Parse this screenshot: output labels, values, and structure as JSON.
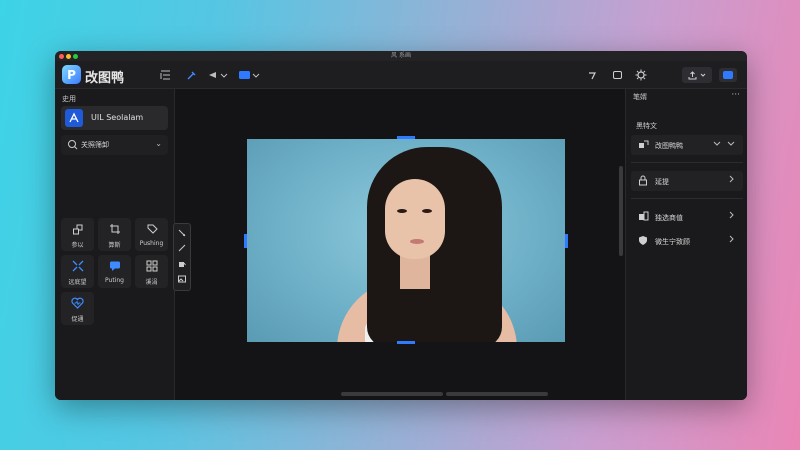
{
  "window": {
    "title": "风 系画"
  },
  "toolbar": {
    "logo_letter": "P",
    "app_name": "改图鸭",
    "icons": [
      "list-icon",
      "brush-icon",
      "brush-size-dropdown-icon",
      "color-dropdown-icon",
      "redo-icon",
      "comment-icon",
      "settings-icon",
      "export-icon",
      "profile-icon"
    ]
  },
  "left_panel": {
    "title": "史用",
    "project": {
      "icon": "pen-tool-icon",
      "name": "UIL Seolalam"
    },
    "preset": {
      "label": "关照筛卸",
      "icon": "spot-heal-icon",
      "chevron": "⌄"
    },
    "tools": [
      {
        "label": "参以",
        "icon": "layers-icon",
        "accent": false
      },
      {
        "label": "算斯",
        "icon": "crop-icon",
        "accent": false
      },
      {
        "label": "Pushing",
        "icon": "tag-icon",
        "accent": false
      },
      {
        "label": "远底望",
        "icon": "expand-icon",
        "accent": true
      },
      {
        "label": "Puting",
        "icon": "chat-icon",
        "accent": true
      },
      {
        "label": "溪涓",
        "icon": "grid-icon",
        "accent": false
      },
      {
        "label": "促通",
        "icon": "heart-icon",
        "accent": true
      }
    ]
  },
  "right_panel": {
    "title": "笔婿",
    "more": "···",
    "subtitle": "黑特文",
    "rows": [
      {
        "label": "改图鸭鸭",
        "icon": "shape-icon"
      },
      {
        "label": "延提",
        "icon": "lock-icon"
      },
      {
        "label": "独选商值",
        "icon": "layers-icon"
      },
      {
        "label": "微生宁致顾",
        "icon": "shield-icon"
      }
    ]
  },
  "colors": {
    "accent": "#2f7bff",
    "window_bg": "#1c1c1e",
    "panel_bg": "#1a1a1c",
    "canvas_bg": "#141416"
  }
}
